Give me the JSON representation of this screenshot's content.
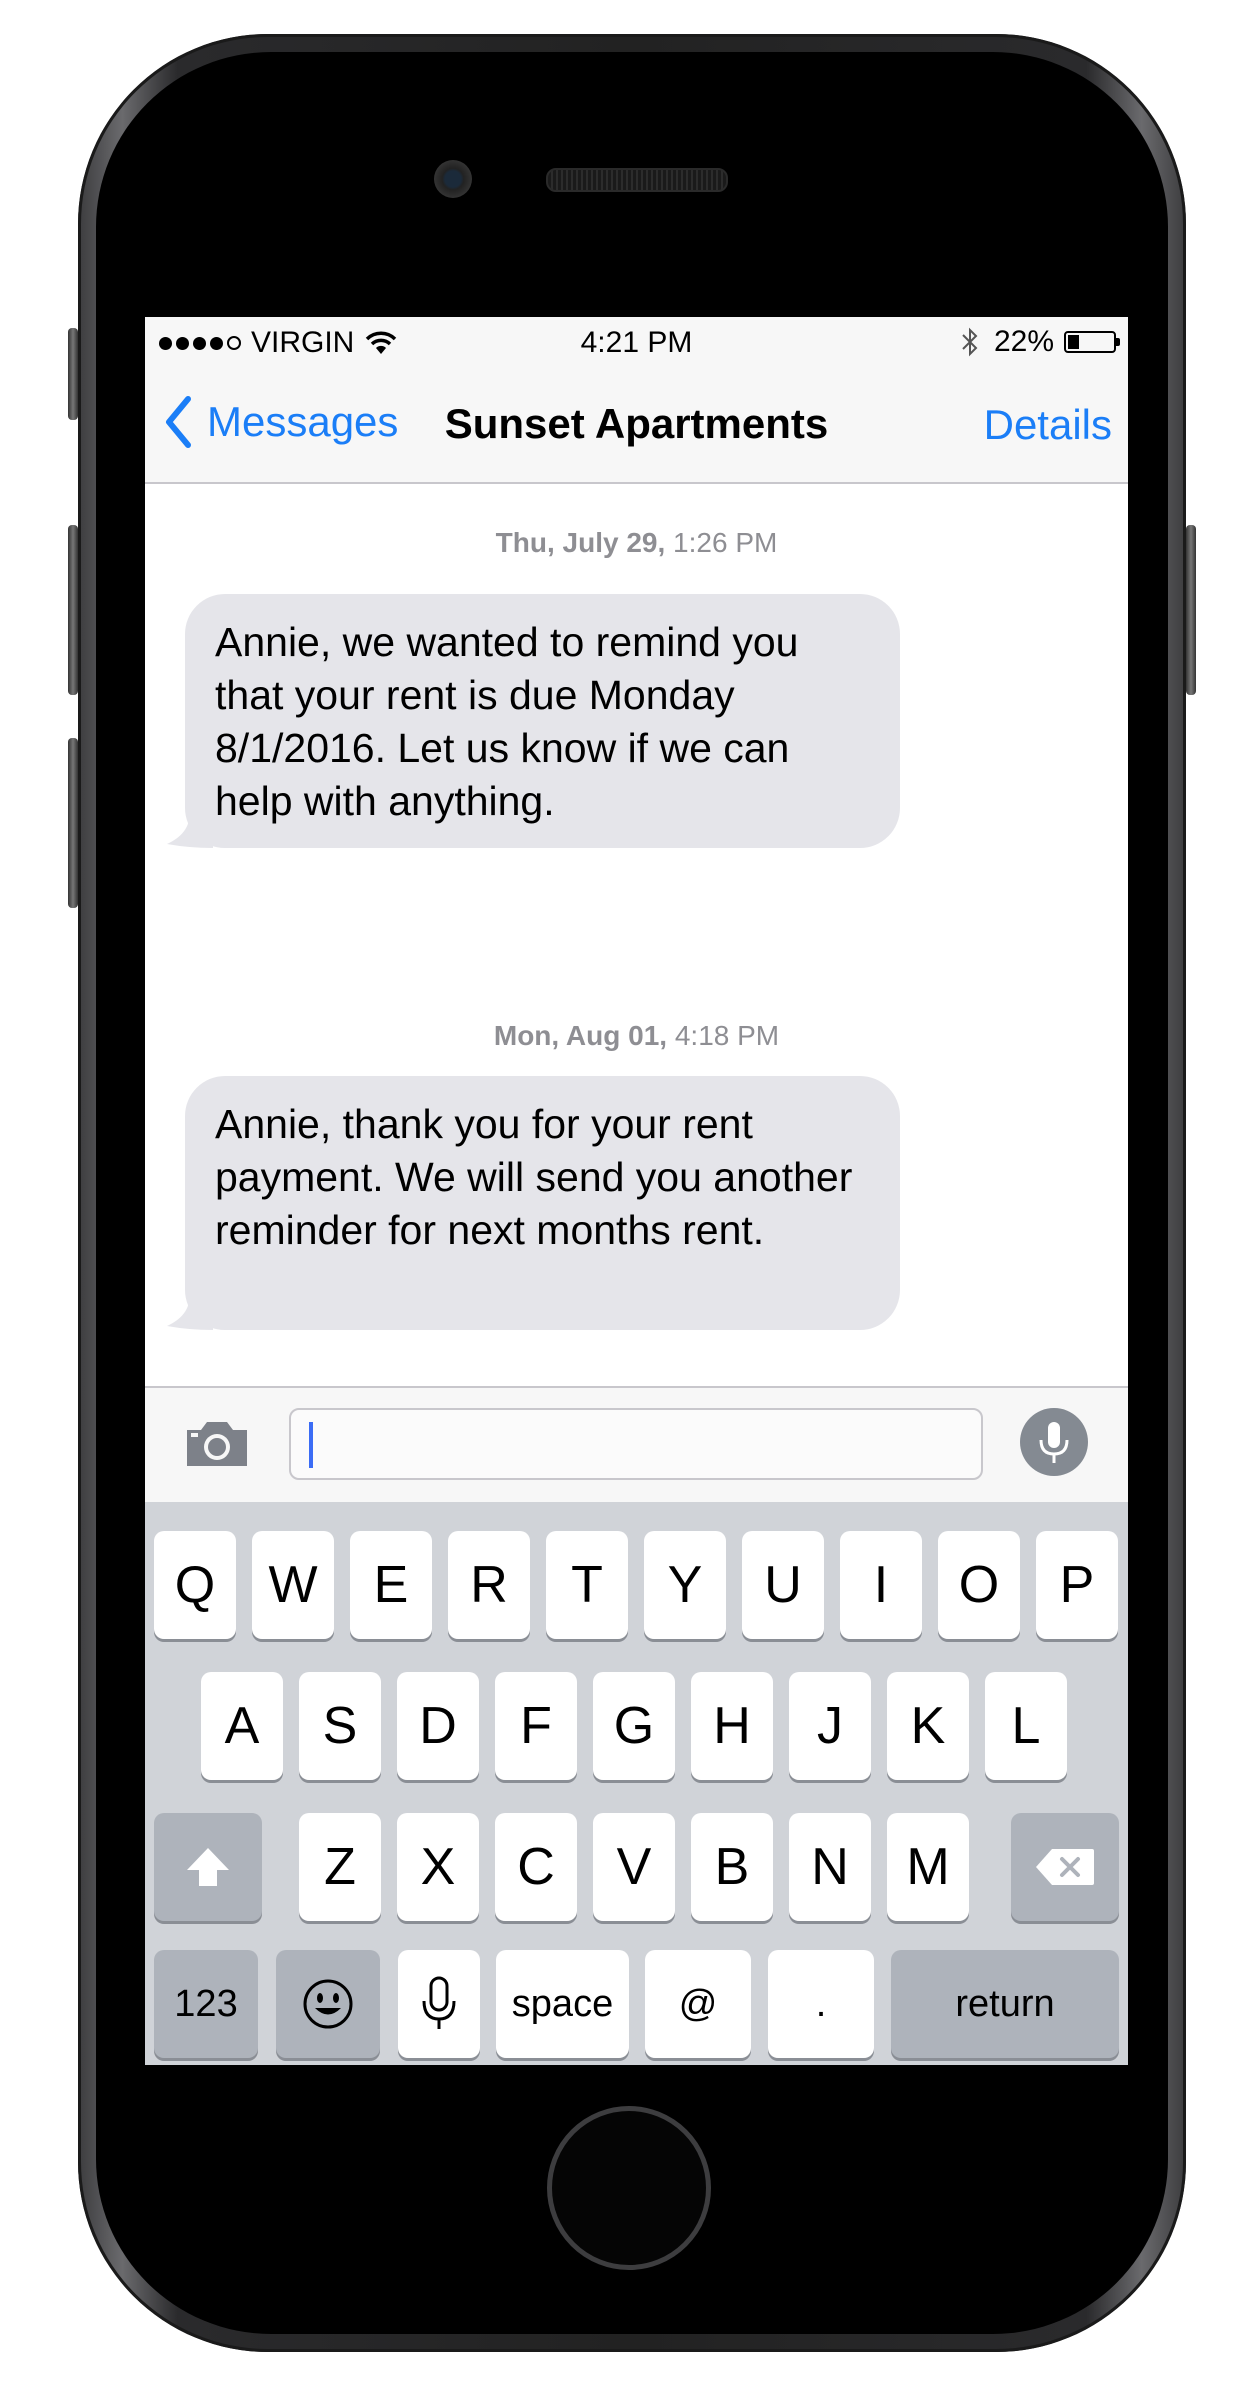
{
  "status": {
    "carrier": "VIRGIN",
    "time": "4:21 PM",
    "battery": "22%",
    "battery_level": 0.22
  },
  "nav": {
    "back_label": "Messages",
    "title": "Sunset Apartments",
    "details_label": "Details"
  },
  "messages": [
    {
      "day": "Thu, July 29,",
      "time": "1:26 PM",
      "text": "Annie, we wanted to remind you that your rent is due Monday 8/1/2016. Let us know if we can help with anything."
    },
    {
      "day": "Mon, Aug 01,",
      "time": "4:18 PM",
      "text": "Annie, thank you for your rent payment. We will send you another reminder for next months rent."
    }
  ],
  "composer": {
    "placeholder": ""
  },
  "keyboard": {
    "row1": [
      "Q",
      "W",
      "E",
      "R",
      "T",
      "Y",
      "U",
      "I",
      "O",
      "P"
    ],
    "row2": [
      "A",
      "S",
      "D",
      "F",
      "G",
      "H",
      "J",
      "K",
      "L"
    ],
    "row3": [
      "Z",
      "X",
      "C",
      "V",
      "B",
      "N",
      "M"
    ],
    "numbers_label": "123",
    "space_label": "space",
    "at_label": "@",
    "period_label": ".",
    "return_label": "return"
  },
  "colors": {
    "accent": "#1b7ef7",
    "bubble": "#e5e5ea",
    "keyboard_bg": "#d0d3d8"
  }
}
